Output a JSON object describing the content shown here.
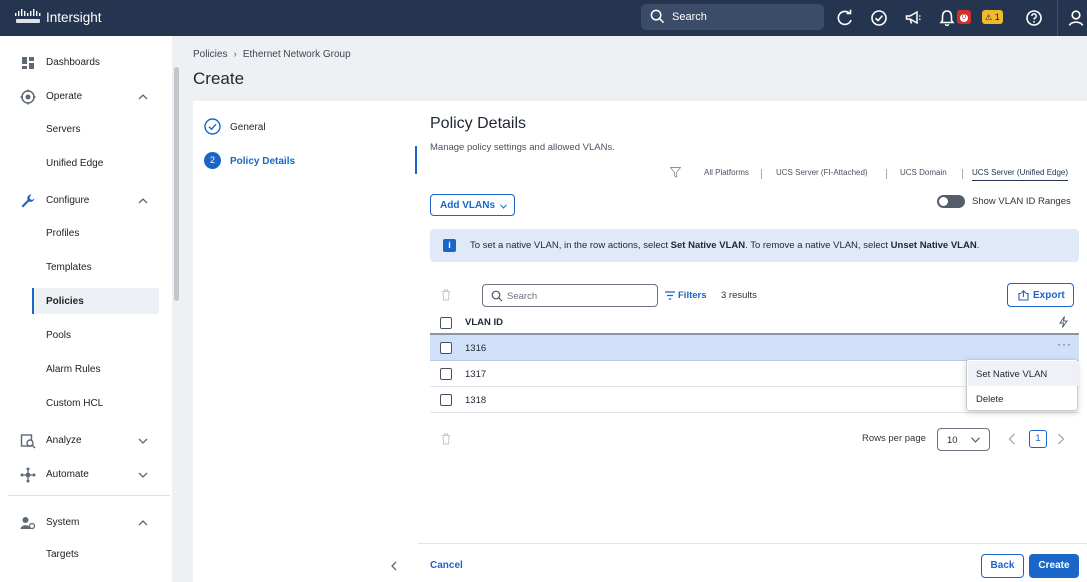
{
  "header": {
    "brand": "Intersight",
    "search_label": "Search",
    "alerts_critical": "0",
    "alerts_warning": "1",
    "colors": {
      "bar": "#253550",
      "critical": "#d0312d",
      "warning": "#f2b92f"
    }
  },
  "sidebar": {
    "dashboards": "Dashboards",
    "operate": "Operate",
    "servers": "Servers",
    "unified_edge": "Unified Edge",
    "configure": "Configure",
    "profiles": "Profiles",
    "templates": "Templates",
    "policies": "Policies",
    "pools": "Pools",
    "alarm_rules": "Alarm Rules",
    "custom_hcl": "Custom HCL",
    "analyze": "Analyze",
    "automate": "Automate",
    "system": "System",
    "targets": "Targets"
  },
  "breadcrumb": {
    "item1": "Policies",
    "item2": "Ethernet Network Group"
  },
  "page_title": "Create",
  "steps": [
    {
      "number": "",
      "label": "General"
    },
    {
      "number": "2",
      "label": "Policy Details"
    }
  ],
  "main": {
    "title": "Policy Details",
    "description": "Manage policy settings and allowed VLANs.",
    "platforms": [
      "All Platforms",
      "UCS Server (FI-Attached)",
      "UCS Domain",
      "UCS Server (Unified Edge)"
    ],
    "add_vlans": "Add VLANs",
    "toggle_label": "Show VLAN ID Ranges",
    "info": {
      "t1": "To set a native VLAN, in the row actions, select ",
      "b1": "Set Native VLAN",
      "t2": ". To remove a native VLAN, select ",
      "b2": "Unset Native VLAN",
      "t3": "."
    },
    "search_placeholder": "Search",
    "filters": "Filters",
    "results": "3 results",
    "export": "Export",
    "column_header": "VLAN ID",
    "rows": [
      "1316",
      "1317",
      "1318"
    ],
    "menu": [
      "Set Native VLAN",
      "Delete"
    ],
    "rows_per_page_label": "Rows per page",
    "rows_per_page": "10",
    "page": "1",
    "cancel": "Cancel",
    "back": "Back",
    "create": "Create",
    "accent": "#1a65c8"
  }
}
